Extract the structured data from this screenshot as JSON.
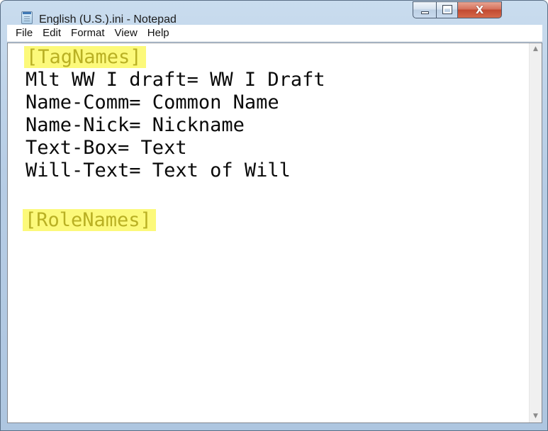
{
  "window": {
    "title": "English (U.S.).ini - Notepad",
    "icon": "notepad-icon",
    "controls": {
      "minimize_icon": "minimize-icon",
      "maximize_icon": "maximize-icon",
      "close_icon": "close-icon",
      "close_glyph": "X"
    }
  },
  "menu": {
    "items": [
      {
        "label": "File"
      },
      {
        "label": "Edit"
      },
      {
        "label": "Format"
      },
      {
        "label": "View"
      },
      {
        "label": "Help"
      }
    ]
  },
  "editor": {
    "lines": [
      {
        "text": "[TagNames]",
        "highlighted": true
      },
      {
        "text": "Mlt WW I draft= WW I Draft",
        "highlighted": false
      },
      {
        "text": "Name-Comm= Common Name",
        "highlighted": false
      },
      {
        "text": "Name-Nick= Nickname",
        "highlighted": false
      },
      {
        "text": "Text-Box= Text",
        "highlighted": false
      },
      {
        "text": "Will-Text= Text of Will",
        "highlighted": false
      },
      {
        "text": "",
        "highlighted": false
      },
      {
        "text": "[RoleNames]",
        "highlighted": true
      }
    ],
    "highlight_color": "#fcf97a",
    "highlight_text_color": "#b9b024"
  },
  "scrollbar": {
    "up_icon": "scroll-up-arrow-icon",
    "down_icon": "scroll-down-arrow-icon",
    "up_glyph": "▲",
    "down_glyph": "▼"
  }
}
